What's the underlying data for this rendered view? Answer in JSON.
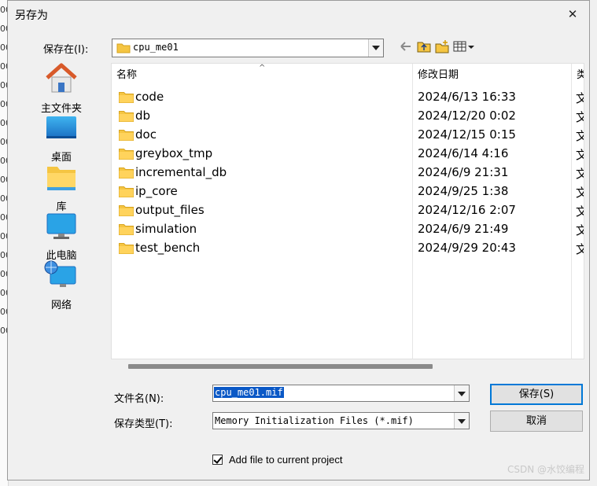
{
  "window": {
    "title": "另存为",
    "close_icon": "close-icon"
  },
  "location": {
    "label": "保存在(I):",
    "value": "cpu_me01"
  },
  "places": [
    {
      "label": "主文件夹",
      "icon": "home-icon"
    },
    {
      "label": "桌面",
      "icon": "desktop-icon"
    },
    {
      "label": "库",
      "icon": "library-icon"
    },
    {
      "label": "此电脑",
      "icon": "computer-icon"
    },
    {
      "label": "网络",
      "icon": "network-icon"
    }
  ],
  "columns": {
    "name": "名称",
    "date": "修改日期",
    "type": "类"
  },
  "files": [
    {
      "name": "code",
      "date": "2024/6/13 16:33",
      "type": "文"
    },
    {
      "name": "db",
      "date": "2024/12/20 0:02",
      "type": "文"
    },
    {
      "name": "doc",
      "date": "2024/12/15 0:15",
      "type": "文"
    },
    {
      "name": "greybox_tmp",
      "date": "2024/6/14 4:16",
      "type": "文"
    },
    {
      "name": "incremental_db",
      "date": "2024/6/9 21:31",
      "type": "文"
    },
    {
      "name": "ip_core",
      "date": "2024/9/25 1:38",
      "type": "文"
    },
    {
      "name": "output_files",
      "date": "2024/12/16 2:07",
      "type": "文"
    },
    {
      "name": "simulation",
      "date": "2024/6/9 21:49",
      "type": "文"
    },
    {
      "name": "test_bench",
      "date": "2024/9/29 20:43",
      "type": "文"
    }
  ],
  "filename": {
    "label": "文件名(N):",
    "value": "cpu_me01.mif"
  },
  "filetype": {
    "label": "保存类型(T):",
    "value": "Memory Initialization Files (*.mif)"
  },
  "buttons": {
    "save": "保存(S)",
    "cancel": "取消"
  },
  "add_to_project": {
    "label": "Add file to current project",
    "checked": true
  },
  "watermark": "CSDN @水饺编程",
  "background_fragments": [
    "00",
    "00",
    "00",
    "00",
    "00",
    "00",
    "00",
    "00",
    "00",
    "00",
    "00",
    "00",
    "00",
    "00",
    "00",
    "00",
    "00",
    "00"
  ],
  "colors": {
    "selection": "#0a58c6",
    "folder": "#f5c542",
    "default_button_border": "#0078d7"
  }
}
